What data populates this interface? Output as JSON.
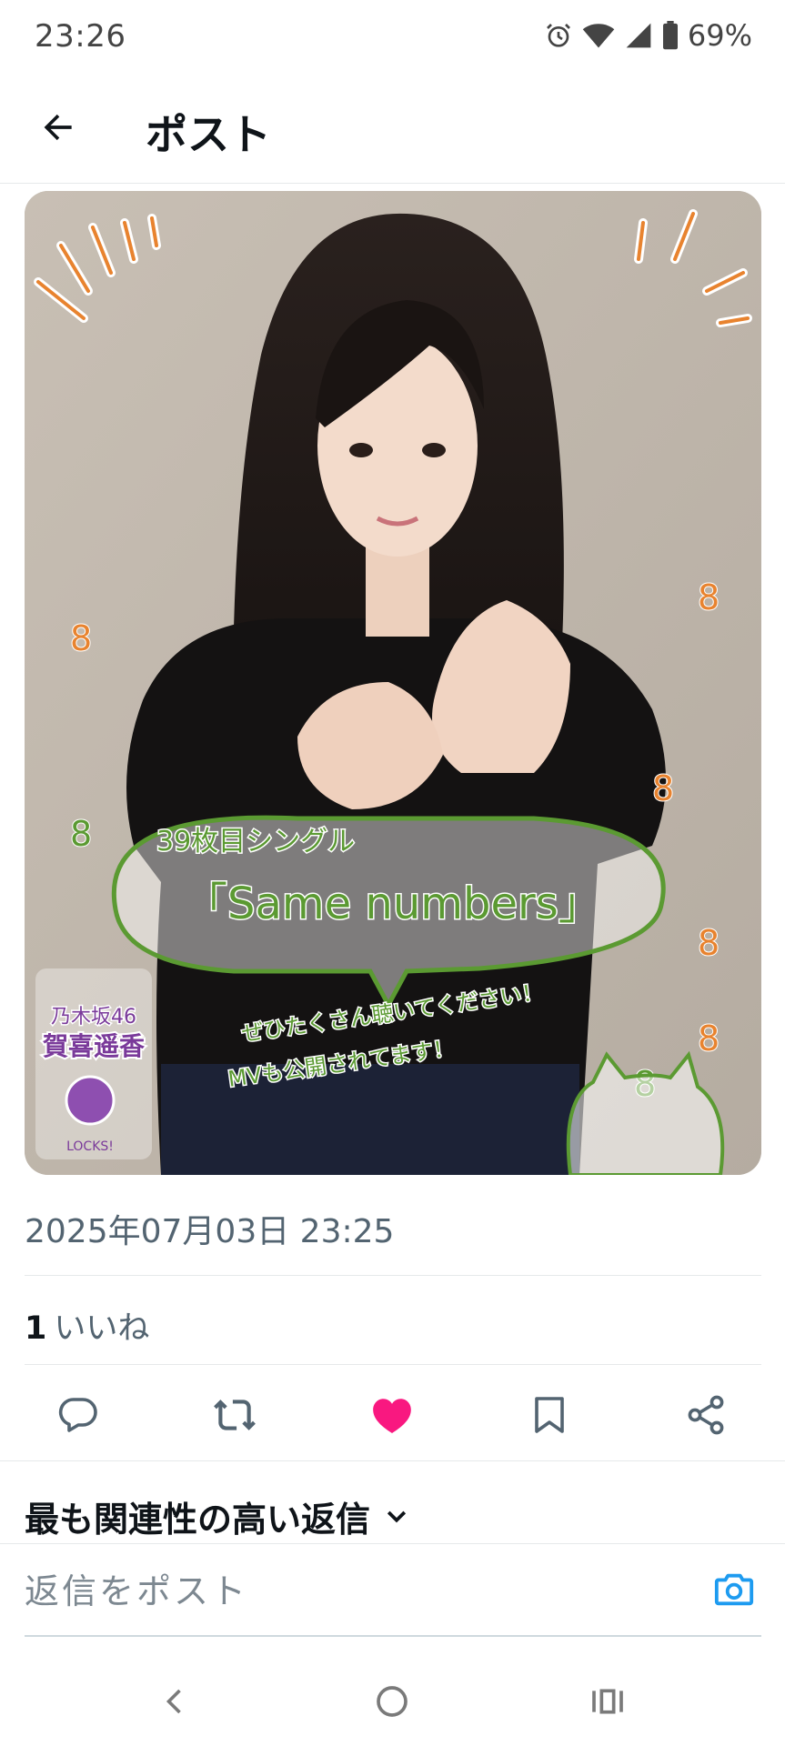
{
  "status_bar": {
    "time": "23:26",
    "battery": "69%"
  },
  "header": {
    "title": "ポスト"
  },
  "post": {
    "image_text": {
      "single": "39枚目シングル",
      "song": "「Same numbers」",
      "message1": "ぜひたくさん聴いてください！",
      "message2": "MVも公開されてます！",
      "logo_line1": "乃木坂46",
      "logo_line2": "賀喜遥香",
      "logo_line3": "LOCKS!"
    },
    "timestamp": "2025年07月03日 23:25",
    "likes_count": "1",
    "likes_label": "いいね"
  },
  "replies": {
    "sort_label": "最も関連性の高い返信"
  },
  "reply_box": {
    "placeholder": "返信をポスト"
  },
  "colors": {
    "like": "#f91880",
    "accent": "#1d9bf0",
    "green": "#5b9a32",
    "orange": "#e8832f"
  },
  "icons": [
    "back-arrow-icon",
    "reply-icon",
    "retweet-icon",
    "heart-icon",
    "bookmark-icon",
    "share-icon",
    "chevron-down-icon",
    "camera-icon"
  ]
}
